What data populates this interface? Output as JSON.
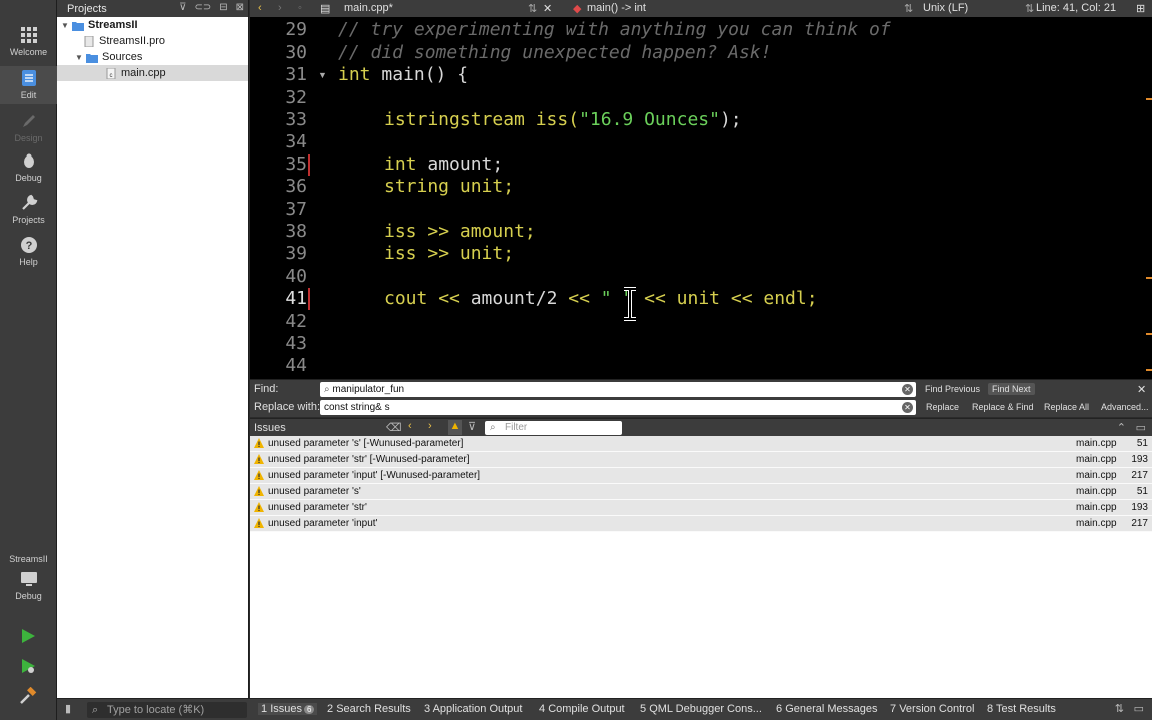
{
  "mode_bar": {
    "items": [
      {
        "label": "Welcome",
        "icon": "grid-icon"
      },
      {
        "label": "Edit",
        "icon": "document-icon"
      },
      {
        "label": "Design",
        "icon": "pen-icon"
      },
      {
        "label": "Debug",
        "icon": "bug-icon"
      },
      {
        "label": "Projects",
        "icon": "wrench-icon"
      },
      {
        "label": "Help",
        "icon": "help-icon"
      }
    ],
    "target_name": "StreamsII",
    "target_mode": "Debug"
  },
  "projects": {
    "title": "Projects",
    "tree": [
      {
        "label": "StreamsII"
      },
      {
        "label": "StreamsII.pro"
      },
      {
        "label": "Sources"
      },
      {
        "label": "main.cpp"
      }
    ]
  },
  "editor_bar": {
    "file": "main.cpp*",
    "symbol": "main() -> int",
    "line_ending": "Unix (LF)",
    "position": "Line: 41, Col: 21"
  },
  "code": {
    "line_numbers": [
      "29",
      "30",
      "31",
      "32",
      "33",
      "34",
      "35",
      "36",
      "37",
      "38",
      "39",
      "40",
      "41",
      "42",
      "43",
      "44"
    ],
    "l29": "// try experimenting with anything you can think of",
    "l30": "// did something unexpected happen? Ask!",
    "l31_kw": "int",
    "l31_rest": " main() {",
    "l33_a": "istringstream iss(",
    "l33_str": "\"16.9 Ounces\"",
    "l33_b": ");",
    "l35_kw": "int",
    "l35_rest": " amount;",
    "l36": "string unit;",
    "l38_a": "iss ",
    "l38_op": ">>",
    "l38_b": " amount;",
    "l39_a": "iss ",
    "l39_op": ">>",
    "l39_b": " unit;",
    "l41_a": "cout ",
    "l41_op1": "<<",
    "l41_b": " amount/2 ",
    "l41_op2": "<<",
    "l41_str": " \" \"",
    "l41_c": " ",
    "l41_op3": "<<",
    "l41_d": " unit ",
    "l41_op4": "<<",
    "l41_e": " endl;"
  },
  "find": {
    "find_label": "Find:",
    "find_value": "manipulator_fun",
    "replace_label": "Replace with:",
    "replace_value": "const string& s",
    "find_previous": "Find Previous",
    "find_next": "Find Next",
    "replace": "Replace",
    "replace_find": "Replace & Find",
    "replace_all": "Replace All",
    "advanced": "Advanced..."
  },
  "issues": {
    "title": "Issues",
    "filter_placeholder": "Filter",
    "rows": [
      {
        "message": "unused parameter 's' [-Wunused-parameter]",
        "file": "main.cpp",
        "line": "51"
      },
      {
        "message": "unused parameter 'str' [-Wunused-parameter]",
        "file": "main.cpp",
        "line": "193"
      },
      {
        "message": "unused parameter 'input' [-Wunused-parameter]",
        "file": "main.cpp",
        "line": "217"
      },
      {
        "message": "unused parameter 's'",
        "file": "main.cpp",
        "line": "51"
      },
      {
        "message": "unused parameter 'str'",
        "file": "main.cpp",
        "line": "193"
      },
      {
        "message": "unused parameter 'input'",
        "file": "main.cpp",
        "line": "217"
      }
    ]
  },
  "status": {
    "locate_placeholder": "Type to locate (⌘K)",
    "tabs": [
      {
        "num": "1",
        "label": "Issues",
        "badge": "6"
      },
      {
        "num": "2",
        "label": "Search Results"
      },
      {
        "num": "3",
        "label": "Application Output"
      },
      {
        "num": "4",
        "label": "Compile Output"
      },
      {
        "num": "5",
        "label": "QML Debugger Cons..."
      },
      {
        "num": "6",
        "label": "General Messages"
      },
      {
        "num": "7",
        "label": "Version Control"
      },
      {
        "num": "8",
        "label": "Test Results"
      }
    ]
  },
  "colors": {
    "keyword": "#d6cf4f",
    "string": "#6bd05b",
    "comment": "#6a6a6a",
    "editor_bg": "#000000",
    "warning": "#f0b400"
  }
}
